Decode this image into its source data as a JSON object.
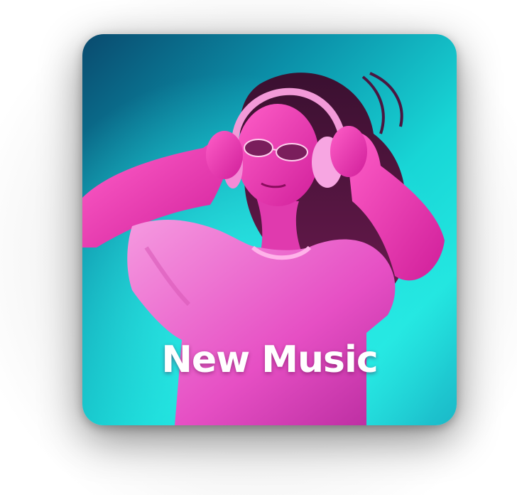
{
  "card": {
    "title": "New Music"
  },
  "colors": {
    "background_teal": "#18d6d6",
    "background_deep": "#0a4a6e",
    "accent_magenta": "#ff2fb8",
    "shirt_pink": "#f27ad6",
    "text": "#ffffff"
  }
}
